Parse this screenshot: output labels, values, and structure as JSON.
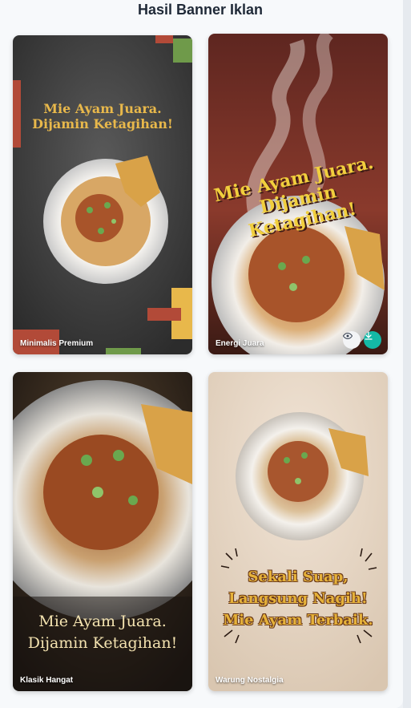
{
  "page": {
    "title": "Hasil Banner Iklan"
  },
  "banners": [
    {
      "label": "Minimalis Premium",
      "headline_1": "Mie Ayam Juara.",
      "headline_2": "Dijamin Ketagihan!"
    },
    {
      "label": "Energi Juara",
      "headline_1": "Mie Ayam Juara.",
      "headline_2": "Dijamin Ketagihan!",
      "actions": {
        "preview_icon": "eye-icon",
        "download_icon": "download-icon"
      }
    },
    {
      "label": "Klasik Hangat",
      "headline_1": "Mie Ayam Juara.",
      "headline_2": "Dijamin Ketagihan!"
    },
    {
      "label": "Warung Nostalgia",
      "headline_1": "Sekali Suap,",
      "headline_2": "Langsung Nagih!",
      "headline_3": "Mie Ayam Terbaik."
    }
  ],
  "colors": {
    "accent_teal": "#14b8a6",
    "gold": "#e8b84b",
    "brick": "#b24a38",
    "olive": "#6f9a4a"
  }
}
